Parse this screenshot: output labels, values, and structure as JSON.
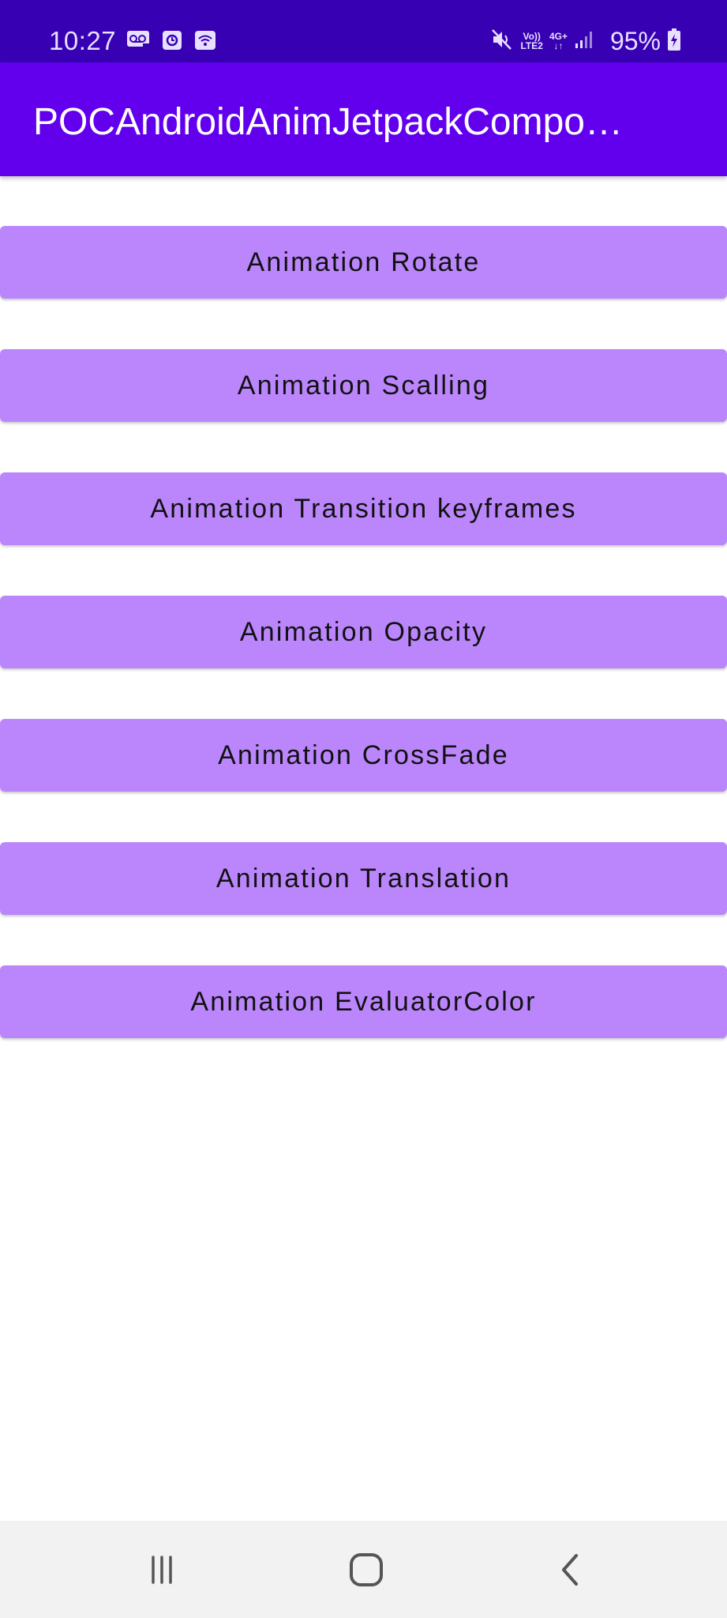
{
  "status_bar": {
    "time": "10:27",
    "battery": "95%",
    "net_top": "Vo))",
    "net_bottom": "LTE2",
    "net_type": "4G+",
    "icons": [
      "voicemail-icon",
      "clock-icon",
      "wifi-icon",
      "mute-icon",
      "signal-icon",
      "battery-charging-icon"
    ]
  },
  "app_bar": {
    "title": "POCAndroidAnimJetpackCompo…"
  },
  "buttons": [
    {
      "label": "Animation Rotate"
    },
    {
      "label": "Animation Scalling"
    },
    {
      "label": "Animation Transition keyframes"
    },
    {
      "label": "Animation Opacity"
    },
    {
      "label": "Animation CrossFade"
    },
    {
      "label": "Animation Translation"
    },
    {
      "label": "Animation EvaluatorColor"
    }
  ],
  "nav_bar": {
    "icons": [
      "recent-apps-icon",
      "home-icon",
      "back-icon"
    ]
  },
  "colors": {
    "status_bar": "#3700b3",
    "app_bar": "#6200ee",
    "button": "#bb86fc",
    "nav_bar": "#f2f2f2"
  }
}
